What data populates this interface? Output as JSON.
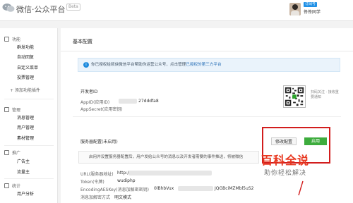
{
  "header": {
    "brand": "微信·公众平台",
    "badge": "Beta",
    "user_type": "订阅号",
    "user_name": "佟佟同学",
    "logo_icon": "wechat-icon"
  },
  "sidebar": {
    "groups": [
      {
        "title": "功能",
        "icon": "function-icon",
        "items": [
          "群发功能",
          "自动回复",
          "自定义菜单",
          "投票管理"
        ]
      },
      {
        "title": "管理",
        "icon": "manage-icon",
        "items": [
          "消息管理",
          "用户管理",
          "素材管理"
        ]
      },
      {
        "title": "推广",
        "icon": "promote-icon",
        "items": [
          "广告主",
          "流量主"
        ]
      },
      {
        "title": "统计",
        "icon": "stats-icon",
        "items": [
          "用户分析"
        ]
      }
    ],
    "add_plugin": "+ 添加功能插件"
  },
  "main": {
    "title": "基本配置",
    "notice_text": "你已授权给硕侠微信平台帮助你运营公众号，点击管理",
    "notice_link": "已授权的第三方平台",
    "developer": {
      "label": "开发者ID",
      "appid_label": "AppID(应用ID)",
      "appid_suffix": "27dddfa8",
      "secret_label": "AppSecret(应用密钥)",
      "qr_caption": "扫码关注 · 接收重要通知"
    },
    "server": {
      "label": "服务器配置(未启用)",
      "modify_button": "修改配置",
      "enable_button": "启用",
      "description": "启用并设置服务器配置后，用户发给公众号的消息以及开发者需要的事件推送，将被微信",
      "url_label": "URL(服务器地址)",
      "url_value": "http://",
      "token_label": "Token(令牌)",
      "token_value": "wudiphp",
      "aes_label": "EncodingAESKey(消息加解密密钥)",
      "aes_value_start": "0lBhbVux",
      "aes_value_end": "JQGBciMZMbl5uS2",
      "mode_label": "消息加解密方式",
      "mode_value": "明文模式"
    }
  },
  "watermark": {
    "title": "百科全说",
    "subtitle": "助你轻松解决"
  },
  "colors": {
    "accent_green": "#3dac3d",
    "highlight_red": "#d21d1d",
    "watermark_red": "#e8371f",
    "notice_blue": "#1e8bdd"
  }
}
